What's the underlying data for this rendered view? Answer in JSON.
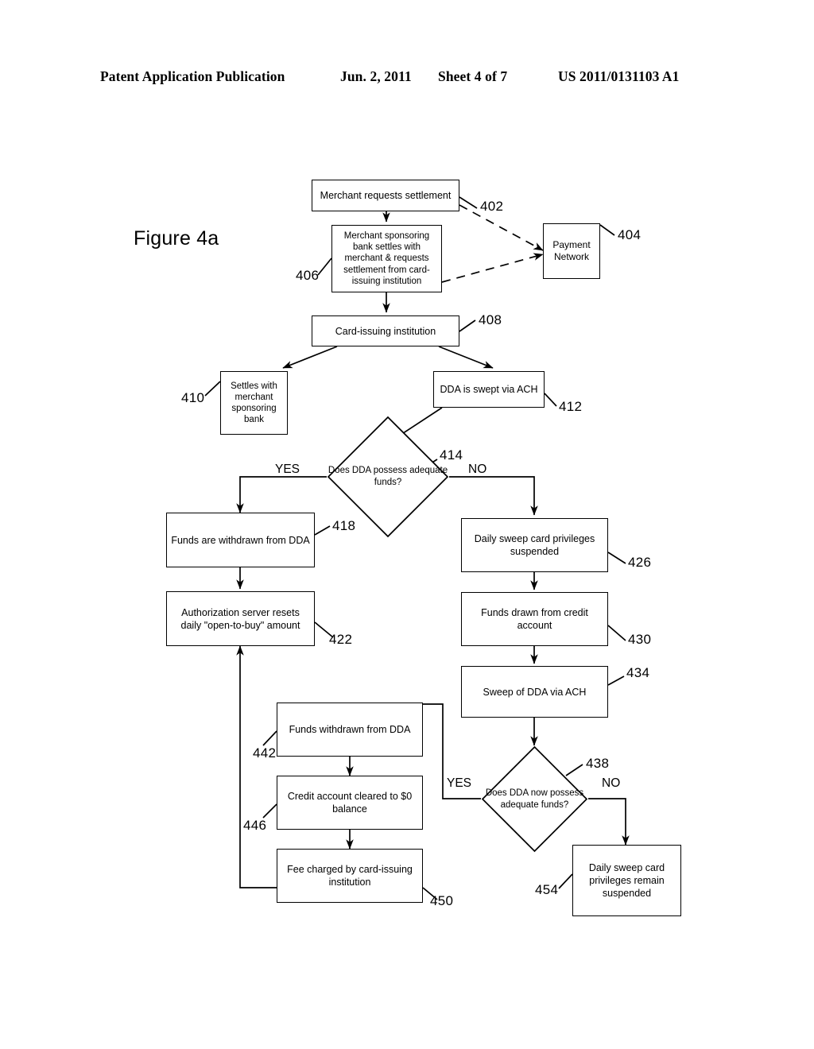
{
  "header": {
    "publication": "Patent Application Publication",
    "date": "Jun. 2, 2011",
    "sheet": "Sheet 4 of 7",
    "number": "US 2011/0131103 A1"
  },
  "figure": {
    "caption": "Figure 4a"
  },
  "diagram": {
    "type": "flowchart",
    "title": "Figure 4a",
    "nodes": [
      {
        "id": "402",
        "shape": "process",
        "label": "Merchant requests settlement"
      },
      {
        "id": "404",
        "shape": "process",
        "label": "Payment Network"
      },
      {
        "id": "406",
        "shape": "process",
        "label": "Merchant sponsoring bank  settles with merchant & requests settlement from card-issuing institution"
      },
      {
        "id": "408",
        "shape": "process",
        "label": "Card-issuing institution"
      },
      {
        "id": "410",
        "shape": "process",
        "label": "Settles with merchant sponsoring bank"
      },
      {
        "id": "412",
        "shape": "process",
        "label": "DDA is swept via ACH"
      },
      {
        "id": "414",
        "shape": "decision",
        "label": "Does DDA possess adequate funds?"
      },
      {
        "id": "418",
        "shape": "process",
        "label": "Funds are withdrawn from DDA"
      },
      {
        "id": "422",
        "shape": "process",
        "label": "Authorization server resets daily \"open-to-buy\" amount"
      },
      {
        "id": "426",
        "shape": "process",
        "label": "Daily sweep card privileges suspended"
      },
      {
        "id": "430",
        "shape": "process",
        "label": "Funds drawn from credit account"
      },
      {
        "id": "434",
        "shape": "process",
        "label": "Sweep of DDA via ACH"
      },
      {
        "id": "438",
        "shape": "decision",
        "label": "Does DDA now possess adequate funds?"
      },
      {
        "id": "442",
        "shape": "process",
        "label": "Funds withdrawn from DDA"
      },
      {
        "id": "446",
        "shape": "process",
        "label": "Credit account cleared to $0 balance"
      },
      {
        "id": "450",
        "shape": "process",
        "label": "Fee charged by card-issuing institution"
      },
      {
        "id": "454",
        "shape": "process",
        "label": "Daily sweep card privileges remain suspended"
      }
    ],
    "branch_labels": [
      {
        "id": "yes-414",
        "text": "YES"
      },
      {
        "id": "no-414",
        "text": "NO"
      },
      {
        "id": "yes-438",
        "text": "YES"
      },
      {
        "id": "no-438",
        "text": "NO"
      }
    ],
    "edges": [
      {
        "from": "402",
        "to": "406",
        "style": "solid"
      },
      {
        "from": "402",
        "to": "404",
        "style": "dashed"
      },
      {
        "from": "406",
        "to": "404",
        "style": "dashed"
      },
      {
        "from": "406",
        "to": "408",
        "style": "solid"
      },
      {
        "from": "408",
        "to": "410",
        "style": "solid"
      },
      {
        "from": "408",
        "to": "412",
        "style": "solid"
      },
      {
        "from": "412",
        "to": "414",
        "style": "solid"
      },
      {
        "from": "414",
        "to": "418",
        "style": "solid",
        "label": "YES"
      },
      {
        "from": "414",
        "to": "426",
        "style": "solid",
        "label": "NO"
      },
      {
        "from": "418",
        "to": "422",
        "style": "solid"
      },
      {
        "from": "426",
        "to": "430",
        "style": "solid"
      },
      {
        "from": "430",
        "to": "434",
        "style": "solid"
      },
      {
        "from": "434",
        "to": "438",
        "style": "solid"
      },
      {
        "from": "438",
        "to": "442",
        "style": "solid",
        "label": "YES"
      },
      {
        "from": "438",
        "to": "454",
        "style": "solid",
        "label": "NO"
      },
      {
        "from": "442",
        "to": "446",
        "style": "solid"
      },
      {
        "from": "446",
        "to": "450",
        "style": "solid"
      },
      {
        "from": "450",
        "to": "422",
        "style": "solid"
      }
    ]
  }
}
